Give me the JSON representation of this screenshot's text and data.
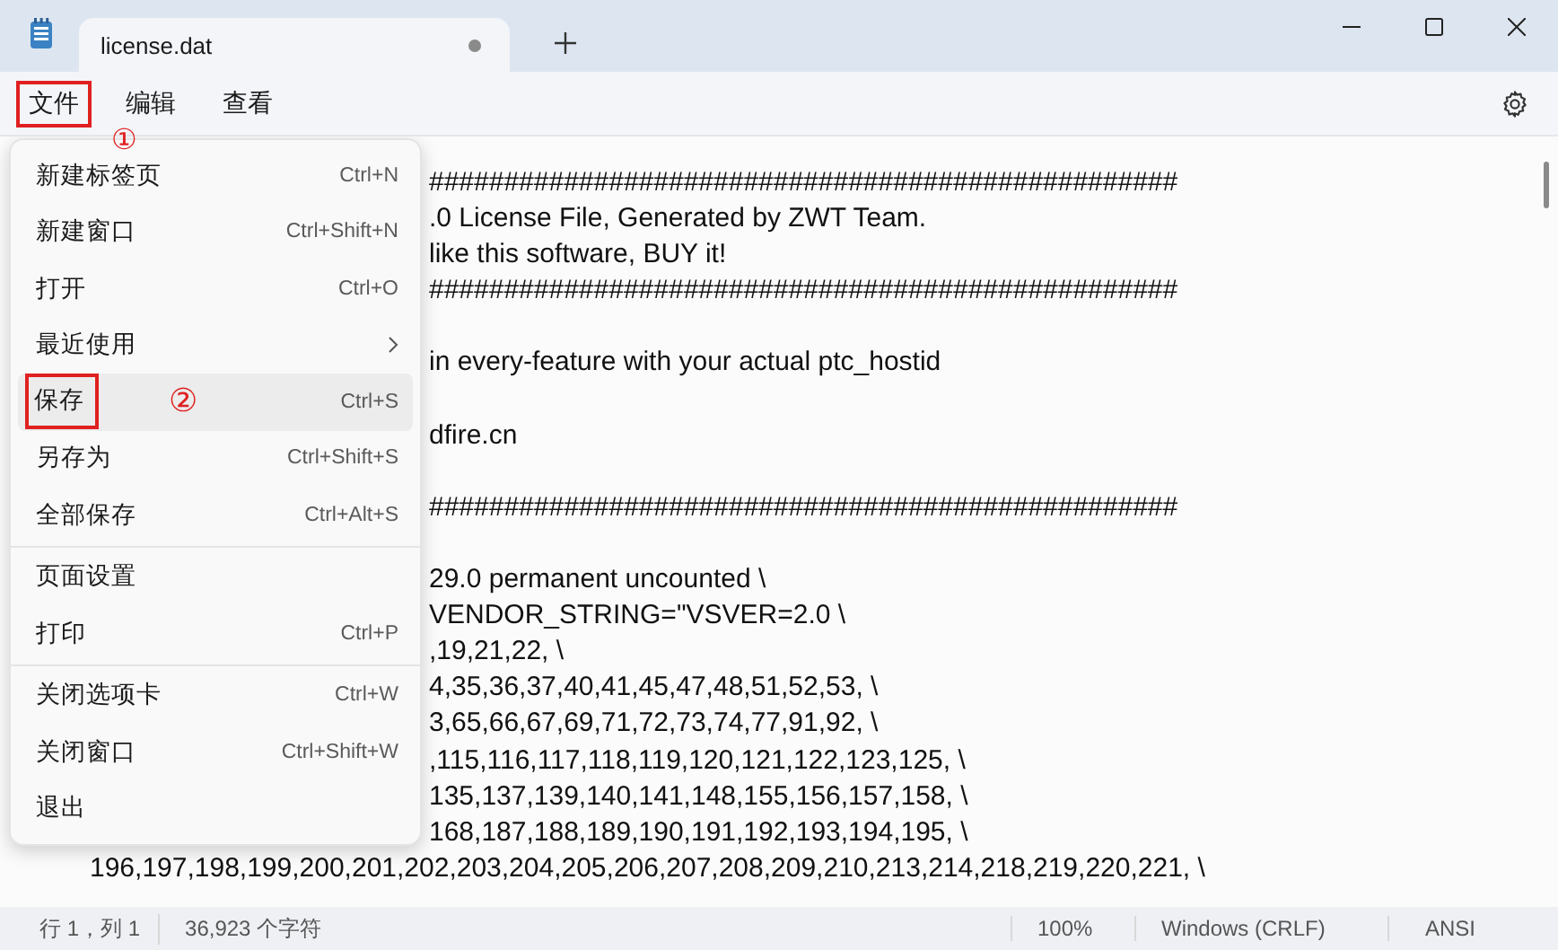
{
  "tab": {
    "title": "license.dat",
    "unsaved": true
  },
  "menubar": [
    {
      "label": "文件",
      "selected": true,
      "annotation": "①"
    },
    {
      "label": "编辑",
      "selected": false
    },
    {
      "label": "查看",
      "selected": false
    }
  ],
  "menu": [
    {
      "label": "新建标签页",
      "shortcut": "Ctrl+N",
      "selected": false
    },
    {
      "label": "新建窗口",
      "shortcut": "Ctrl+Shift+N",
      "selected": false
    },
    {
      "label": "打开",
      "shortcut": "Ctrl+O",
      "selected": false
    },
    {
      "label": "最近使用",
      "submenu": true,
      "selected": false
    },
    {
      "label": "保存",
      "shortcut": "Ctrl+S",
      "selected": true,
      "annotation": "②"
    },
    {
      "label": "另存为",
      "shortcut": "Ctrl+Shift+S",
      "selected": false
    },
    {
      "label": "全部保存",
      "shortcut": "Ctrl+Alt+S",
      "selected": false,
      "separator_after": true
    },
    {
      "label": "页面设置",
      "selected": false
    },
    {
      "label": "打印",
      "shortcut": "Ctrl+P",
      "selected": false,
      "separator_after": true
    },
    {
      "label": "关闭选项卡",
      "shortcut": "Ctrl+W",
      "selected": false
    },
    {
      "label": "关闭窗口",
      "shortcut": "Ctrl+Shift+W",
      "selected": false
    },
    {
      "label": "退出",
      "selected": false
    }
  ],
  "editor_lines": [
    {
      "kind": "clipped",
      "text": "##################################################"
    },
    {
      "kind": "clipped",
      "text": ".0 License File, Generated by ZWT Team."
    },
    {
      "kind": "clipped",
      "text": "like this software, BUY it!"
    },
    {
      "kind": "clipped",
      "text": "##################################################"
    },
    {
      "kind": "blank"
    },
    {
      "kind": "clipped",
      "text": "in every-feature with your actual ptc_hostid"
    },
    {
      "kind": "blank"
    },
    {
      "kind": "clipped",
      "text": "dfire.cn"
    },
    {
      "kind": "blank"
    },
    {
      "kind": "clipped",
      "text": "##################################################"
    },
    {
      "kind": "blank"
    },
    {
      "kind": "clipped",
      "text": "29.0 permanent uncounted \\"
    },
    {
      "kind": "clipped",
      "text": "VENDOR_STRING=\"VSVER=2.0 \\"
    },
    {
      "kind": "clipped",
      "text": ",19,21,22, \\"
    },
    {
      "kind": "clipped",
      "text": "4,35,36,37,40,41,45,47,48,51,52,53, \\"
    },
    {
      "kind": "clipped",
      "text": "3,65,66,67,69,71,72,73,74,77,91,92, \\"
    },
    {
      "kind": "clipped",
      "text": ",115,116,117,118,119,120,121,122,123,125, \\"
    },
    {
      "kind": "clipped",
      "text": "135,137,139,140,141,148,155,156,157,158, \\"
    },
    {
      "kind": "clipped",
      "text": "168,187,188,189,190,191,192,193,194,195, \\"
    },
    {
      "kind": "full",
      "text": "196,197,198,199,200,201,202,203,204,205,206,207,208,209,210,213,214,218,219,220,221,  \\"
    }
  ],
  "status_bar": {
    "position": "行 1，列 1",
    "characters": "36,923 个字符",
    "zoom": "100%",
    "line_ending": "Windows (CRLF)",
    "encoding": "ANSI"
  }
}
